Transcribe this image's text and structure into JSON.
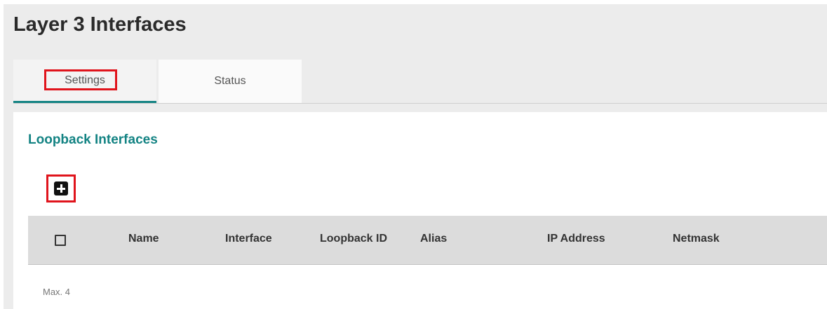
{
  "page": {
    "title": "Layer 3 Interfaces"
  },
  "tabs": [
    {
      "label": "Settings",
      "active": true
    },
    {
      "label": "Status",
      "active": false
    }
  ],
  "section": {
    "title": "Loopback Interfaces",
    "add_icon": "plus-square-icon",
    "table": {
      "columns": [
        "Name",
        "Interface",
        "Loopback ID",
        "Alias",
        "IP Address",
        "Netmask"
      ],
      "rows": []
    },
    "max_note": "Max. 4"
  },
  "colors": {
    "accent": "#138383",
    "highlight": "#e0141c",
    "header_bg": "#dcdcdc",
    "page_bg": "#ececec"
  }
}
